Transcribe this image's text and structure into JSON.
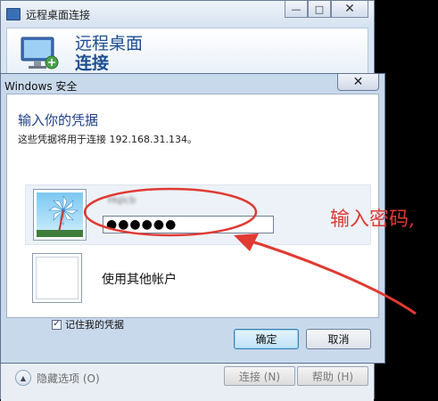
{
  "background_window": {
    "title": "远程桌面连接",
    "minimize_symbol": "—",
    "maximize_symbol": "□",
    "close_symbol": "✕",
    "header_line1": "远程桌面",
    "header_line2": "连接",
    "hide_options": "隐藏选项 (O)",
    "connect_button": "连接 (N)",
    "help_button": "帮助 (H)"
  },
  "dialog": {
    "title": "Windows 安全",
    "close_symbol": "✕",
    "heading": "输入你的凭据",
    "subtext": "这些凭据将用于连接 192.168.31.134。",
    "username": "Hqlcb",
    "password_masked": "●●●●●●",
    "other_account": "使用其他帐户",
    "remember_label": "记住我的凭据",
    "remember_checked": true,
    "ok_button": "确定",
    "cancel_button": "取消"
  },
  "annotation": {
    "text": "输入密码,",
    "color": "#e03a32"
  },
  "icons": {
    "app": "remote-desktop-icon",
    "header": "monitor-icon",
    "avatar": "user-avatar-icon",
    "expand": "chevron-up-icon"
  }
}
